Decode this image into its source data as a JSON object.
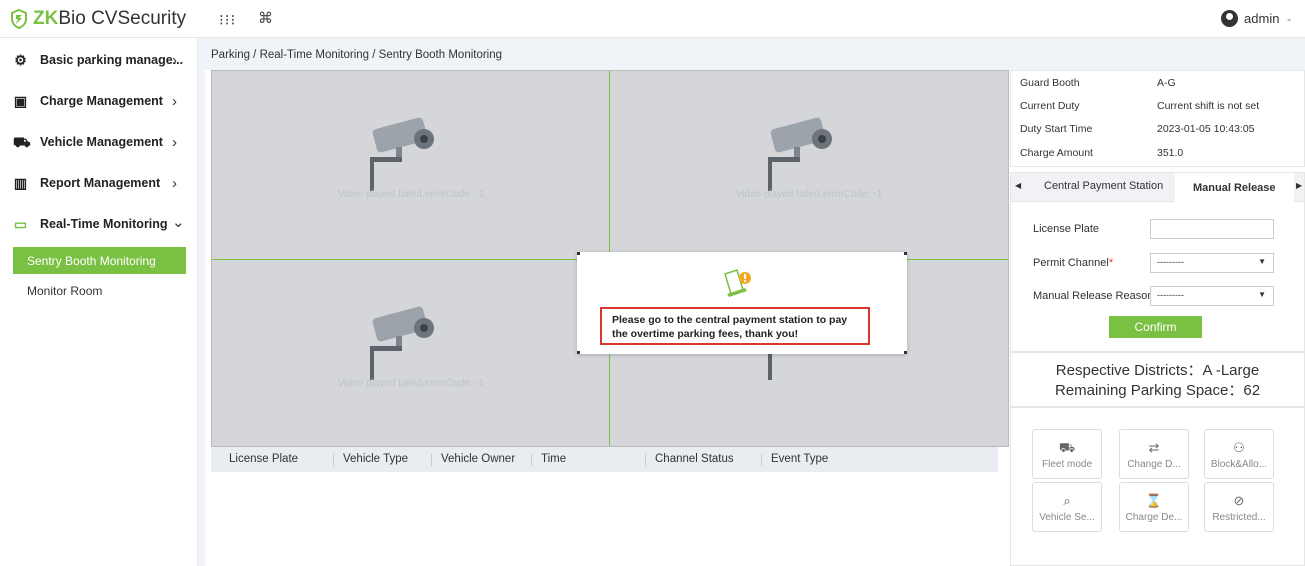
{
  "app": {
    "logo_prefix": "ZK",
    "logo_suffix": "Bio CVSecurity"
  },
  "topbar": {
    "user": "admin"
  },
  "sidebar": {
    "items": [
      {
        "label": "Basic parking manage...",
        "icon": "parking-settings-icon",
        "chevron": "›"
      },
      {
        "label": "Charge Management",
        "icon": "charge-icon",
        "chevron": "›"
      },
      {
        "label": "Vehicle Management",
        "icon": "vehicle-icon",
        "chevron": "›"
      },
      {
        "label": "Report Management",
        "icon": "report-icon",
        "chevron": "›"
      },
      {
        "label": "Real-Time Monitoring",
        "icon": "monitor-icon",
        "chevron": "⌄"
      }
    ],
    "subitems": [
      "Sentry Booth Monitoring",
      "Monitor Room"
    ]
  },
  "breadcrumb": "Parking / Real-Time Monitoring / Sentry Booth Monitoring",
  "video": {
    "error": "Video played failed,errorCode: -1"
  },
  "table": {
    "columns": [
      "License Plate",
      "Vehicle Type",
      "Vehicle Owner",
      "Time",
      "Channel Status",
      "Event Type"
    ]
  },
  "info": [
    {
      "key": "Guard Booth",
      "value": "A-G"
    },
    {
      "key": "Current Duty",
      "value": "Current shift is not set"
    },
    {
      "key": "Duty Start Time",
      "value": "2023-01-05 10:43:05"
    },
    {
      "key": "Charge Amount",
      "value": "351.0"
    }
  ],
  "tabs": {
    "left": "Central Payment Station",
    "active": "Manual Release"
  },
  "form": {
    "license_plate": "License Plate",
    "permit_channel": "Permit Channel",
    "permit_channel_value": "---------",
    "reason": "Manual Release Reason",
    "reason_value": "---------",
    "confirm": "Confirm"
  },
  "district": {
    "line1": "Respective Districts：A -Large",
    "line2": "Remaining Parking Space：62"
  },
  "actions": [
    {
      "label": "Fleet mode",
      "icon": "fleet-icon"
    },
    {
      "label": "Change D...",
      "icon": "change-icon"
    },
    {
      "label": "Block&Allo...",
      "icon": "block-allow-icon"
    },
    {
      "label": "Vehicle Se...",
      "icon": "vehicle-search-icon"
    },
    {
      "label": "Charge De...",
      "icon": "charge-detail-icon"
    },
    {
      "label": "Restricted...",
      "icon": "restricted-icon"
    }
  ],
  "modal": {
    "message": "Please go to the central payment station to pay the overtime parking fees, thank you!"
  },
  "colors": {
    "accent": "#7ac143",
    "alert_border": "#d9372e"
  }
}
